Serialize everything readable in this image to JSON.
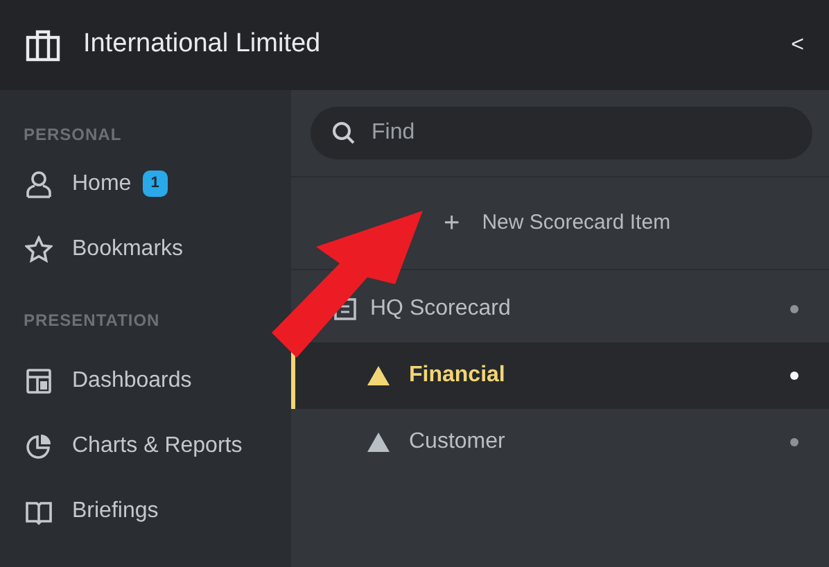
{
  "header": {
    "title": "International Limited",
    "collapse": "<"
  },
  "sidebar": {
    "sections": [
      {
        "heading": "PERSONAL",
        "items": [
          {
            "label": "Home",
            "badge": "1"
          },
          {
            "label": "Bookmarks"
          }
        ]
      },
      {
        "heading": "PRESENTATION",
        "items": [
          {
            "label": "Dashboards"
          },
          {
            "label": "Charts & Reports"
          },
          {
            "label": "Briefings"
          }
        ]
      }
    ]
  },
  "search": {
    "placeholder": "Find"
  },
  "new_item": {
    "icon": "+",
    "label": "New Scorecard Item"
  },
  "tree": [
    {
      "label": "HQ Scorecard",
      "kind": "scorecard",
      "selected": false,
      "children": [
        {
          "label": "Financial",
          "kind": "objective",
          "color": "#f2d675",
          "selected": true
        },
        {
          "label": "Customer",
          "kind": "objective",
          "color": "#b8bfc5",
          "selected": false
        }
      ]
    }
  ],
  "annotation": {
    "arrow": true
  }
}
